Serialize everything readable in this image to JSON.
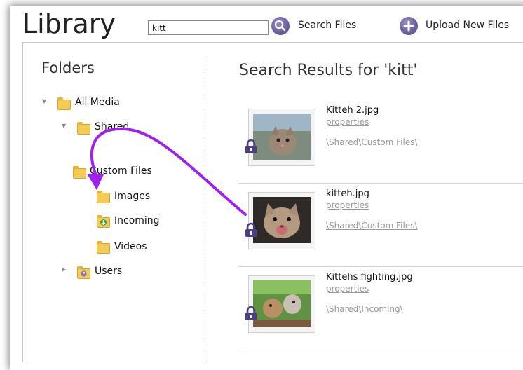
{
  "header": {
    "title": "Library",
    "search_value": "kitt",
    "search_button_label": "Search Files",
    "upload_button_label": "Upload New Files"
  },
  "folders": {
    "heading": "Folders",
    "items": [
      {
        "label": "All Media"
      },
      {
        "label": "Shared"
      },
      {
        "label": "Custom Files"
      },
      {
        "label": "Images"
      },
      {
        "label": "Incoming"
      },
      {
        "label": "Videos"
      },
      {
        "label": "Users"
      }
    ]
  },
  "results": {
    "heading": "Search Results for 'kitt'",
    "items": [
      {
        "filename": "Kitteh 2.jpg",
        "properties_label": "properties",
        "path": "\\Shared\\Custom Files\\"
      },
      {
        "filename": "kitteh.jpg",
        "properties_label": "properties",
        "path": "\\Shared\\Custom Files\\"
      },
      {
        "filename": "Kittehs fighting.jpg",
        "properties_label": "properties",
        "path": "\\Shared\\Incoming\\"
      }
    ]
  },
  "colors": {
    "accent_purple": "#5a4a93",
    "drag_arrow": "#a020f0",
    "folder_yellow": "#f3cc55"
  },
  "icons": [
    "search-icon",
    "upload-plus-icon",
    "folder-icon",
    "lock-icon",
    "expand-arrow-icon",
    "collapse-arrow-icon"
  ]
}
